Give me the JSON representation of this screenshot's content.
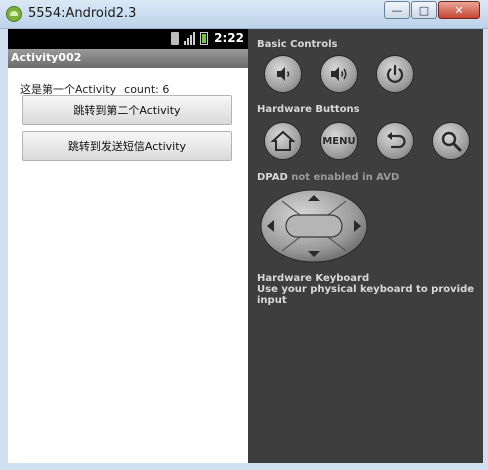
{
  "window": {
    "title": "5554:Android2.3",
    "min_glyph": "—",
    "max_glyph": "□",
    "close_glyph": "✕"
  },
  "device": {
    "status_time": "2:22",
    "app_title": "Activity002",
    "content_text": "这是第一个Activity",
    "count_text": "count: 6",
    "button1_label": "跳转到第二个Activity",
    "button2_label": "跳转到发送短信Activity"
  },
  "panel": {
    "basic_controls_title": "Basic Controls",
    "hardware_buttons_title": "Hardware Buttons",
    "menu_label": "MENU",
    "dpad_title": "DPAD",
    "dpad_note": "not enabled in AVD",
    "keyboard_title": "Hardware Keyboard",
    "keyboard_note": "Use your physical keyboard to provide input"
  },
  "icons": {
    "volume_down": "volume-down-icon",
    "volume_up": "volume-up-icon",
    "power": "power-icon",
    "home": "home-icon",
    "back": "back-icon",
    "search": "search-icon"
  },
  "colors": {
    "titlebar": "#cfe0f1",
    "panel_bg": "#3e3e3e",
    "statusbar": "#000000",
    "appbar": "#7a7a7a",
    "close_button": "#c74533",
    "battery": "#6dcc33"
  }
}
